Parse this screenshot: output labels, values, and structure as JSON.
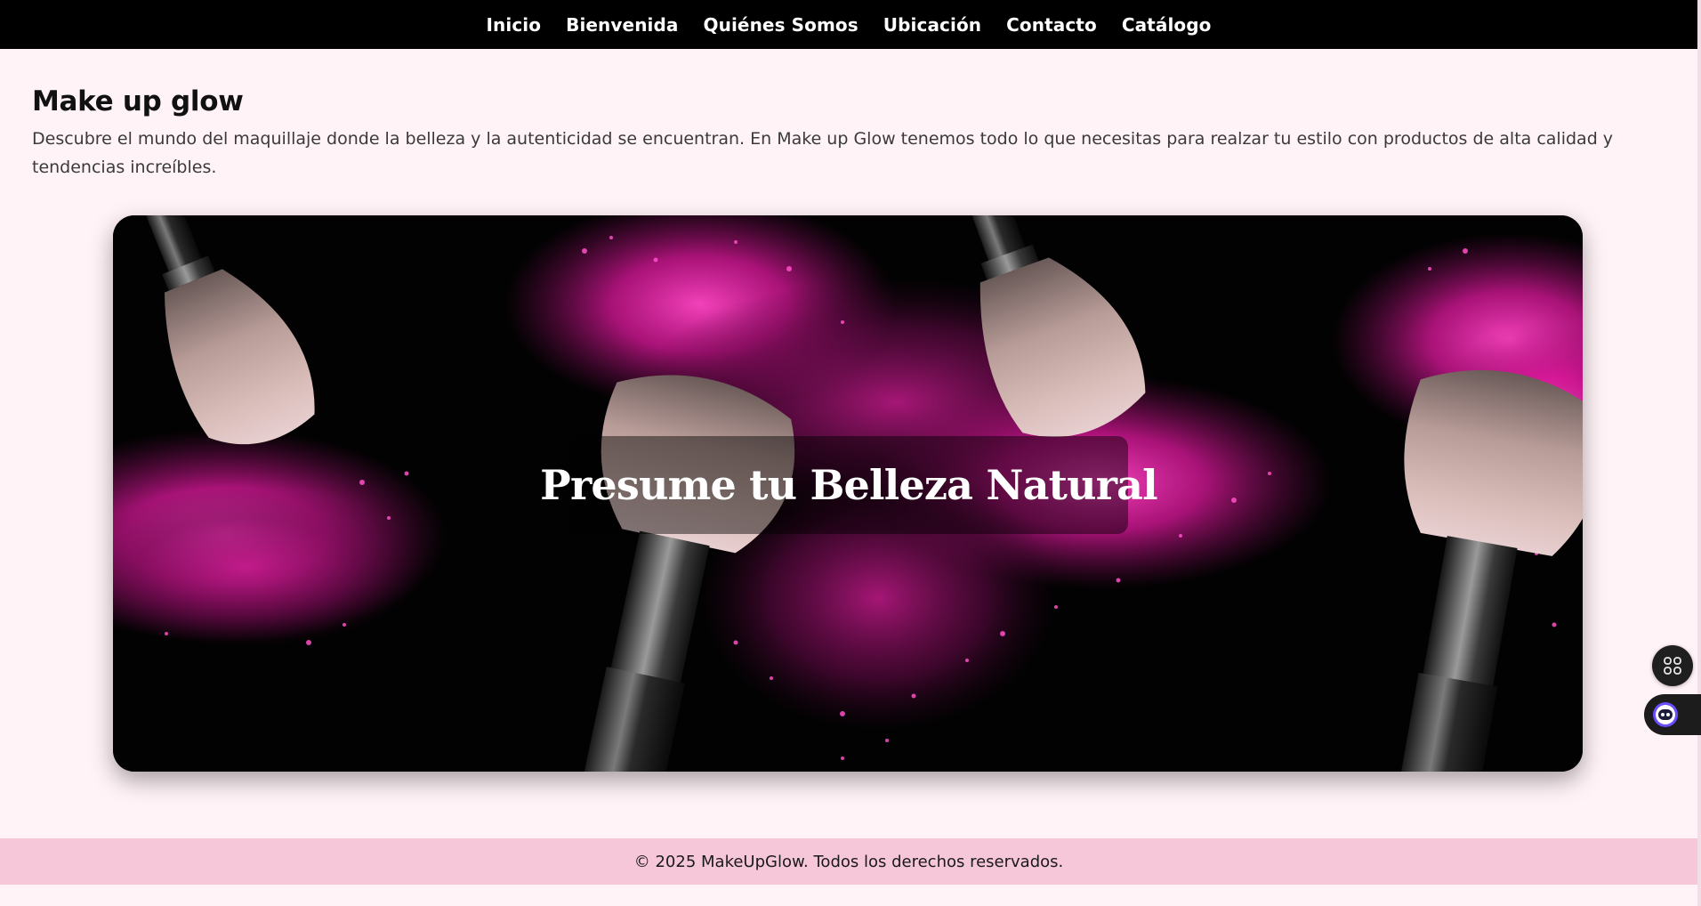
{
  "nav": {
    "items": [
      {
        "label": "Inicio"
      },
      {
        "label": "Bienvenida"
      },
      {
        "label": "Quiénes Somos"
      },
      {
        "label": "Ubicación"
      },
      {
        "label": "Contacto"
      },
      {
        "label": "Catálogo"
      }
    ]
  },
  "intro": {
    "title": "Make up glow",
    "description": "Descubre el mundo del maquillaje donde la belleza y la autenticidad se encuentran. En Make up Glow tenemos todo lo que necesitas para realzar tu estilo con productos de alta calidad y tendencias increíbles."
  },
  "hero": {
    "caption": "Presume tu Belleza Natural",
    "image_subject": "makeup brushes with pink powder on black background"
  },
  "floating": {
    "apps_icon": "apps-grid-icon",
    "assistant_icon": "robot-assistant-icon"
  },
  "footer": {
    "text": "© 2025 MakeUpGlow. Todos los derechos reservados."
  },
  "colors": {
    "nav_bg": "#000000",
    "page_bg": "#fff3f7",
    "footer_bg": "#f6c6d9",
    "powder_pink": "#ff2bb8"
  }
}
